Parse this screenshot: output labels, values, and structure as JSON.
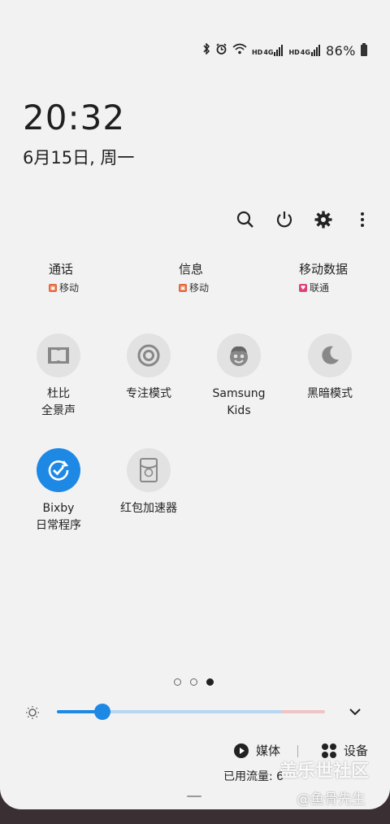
{
  "status_bar": {
    "battery": "86%",
    "icons": [
      "bluetooth-icon",
      "alarm-icon",
      "wifi-icon",
      "hd-4g-signal-icon",
      "hd-4g-signal-icon",
      "battery-icon"
    ],
    "net_label_1": "HD",
    "net_label_2": "4G",
    "net_label_3": "HD",
    "net_label_4": "4G"
  },
  "clock": {
    "time": "20:32",
    "date": "6月15日, 周一"
  },
  "top_actions": [
    "search-icon",
    "power-icon",
    "settings-icon",
    "more-icon"
  ],
  "sim": [
    {
      "label": "通话",
      "sub": "移动",
      "badge_color": "#e5673c"
    },
    {
      "label": "信息",
      "sub": "移动",
      "badge_color": "#e5673c"
    },
    {
      "label": "移动数据",
      "sub": "联通",
      "badge_color": "#e0417a"
    }
  ],
  "tiles": [
    {
      "label": "杜比\n全景声",
      "icon": "dolby-icon",
      "active": false
    },
    {
      "label": "专注模式",
      "icon": "focus-mode-icon",
      "active": false
    },
    {
      "label": "Samsung\nKids",
      "icon": "samsung-kids-icon",
      "active": false
    },
    {
      "label": "黑暗模式",
      "icon": "dark-mode-icon",
      "active": false
    },
    {
      "label": "Bixby\n日常程序",
      "icon": "bixby-routines-icon",
      "active": true
    },
    {
      "label": "红包加速器",
      "icon": "red-envelope-icon",
      "active": false
    }
  ],
  "pager": {
    "pages": 3,
    "current": 3
  },
  "brightness": {
    "level": 0.17
  },
  "media": {
    "media_label": "媒体",
    "devices_label": "设备"
  },
  "usage": {
    "text": "已用流量: 6"
  },
  "watermark": {
    "line1": "盖乐世社区",
    "line2": "@鱼骨先生"
  },
  "colors": {
    "accent": "#1e88e5",
    "background": "#f2f2f2"
  }
}
